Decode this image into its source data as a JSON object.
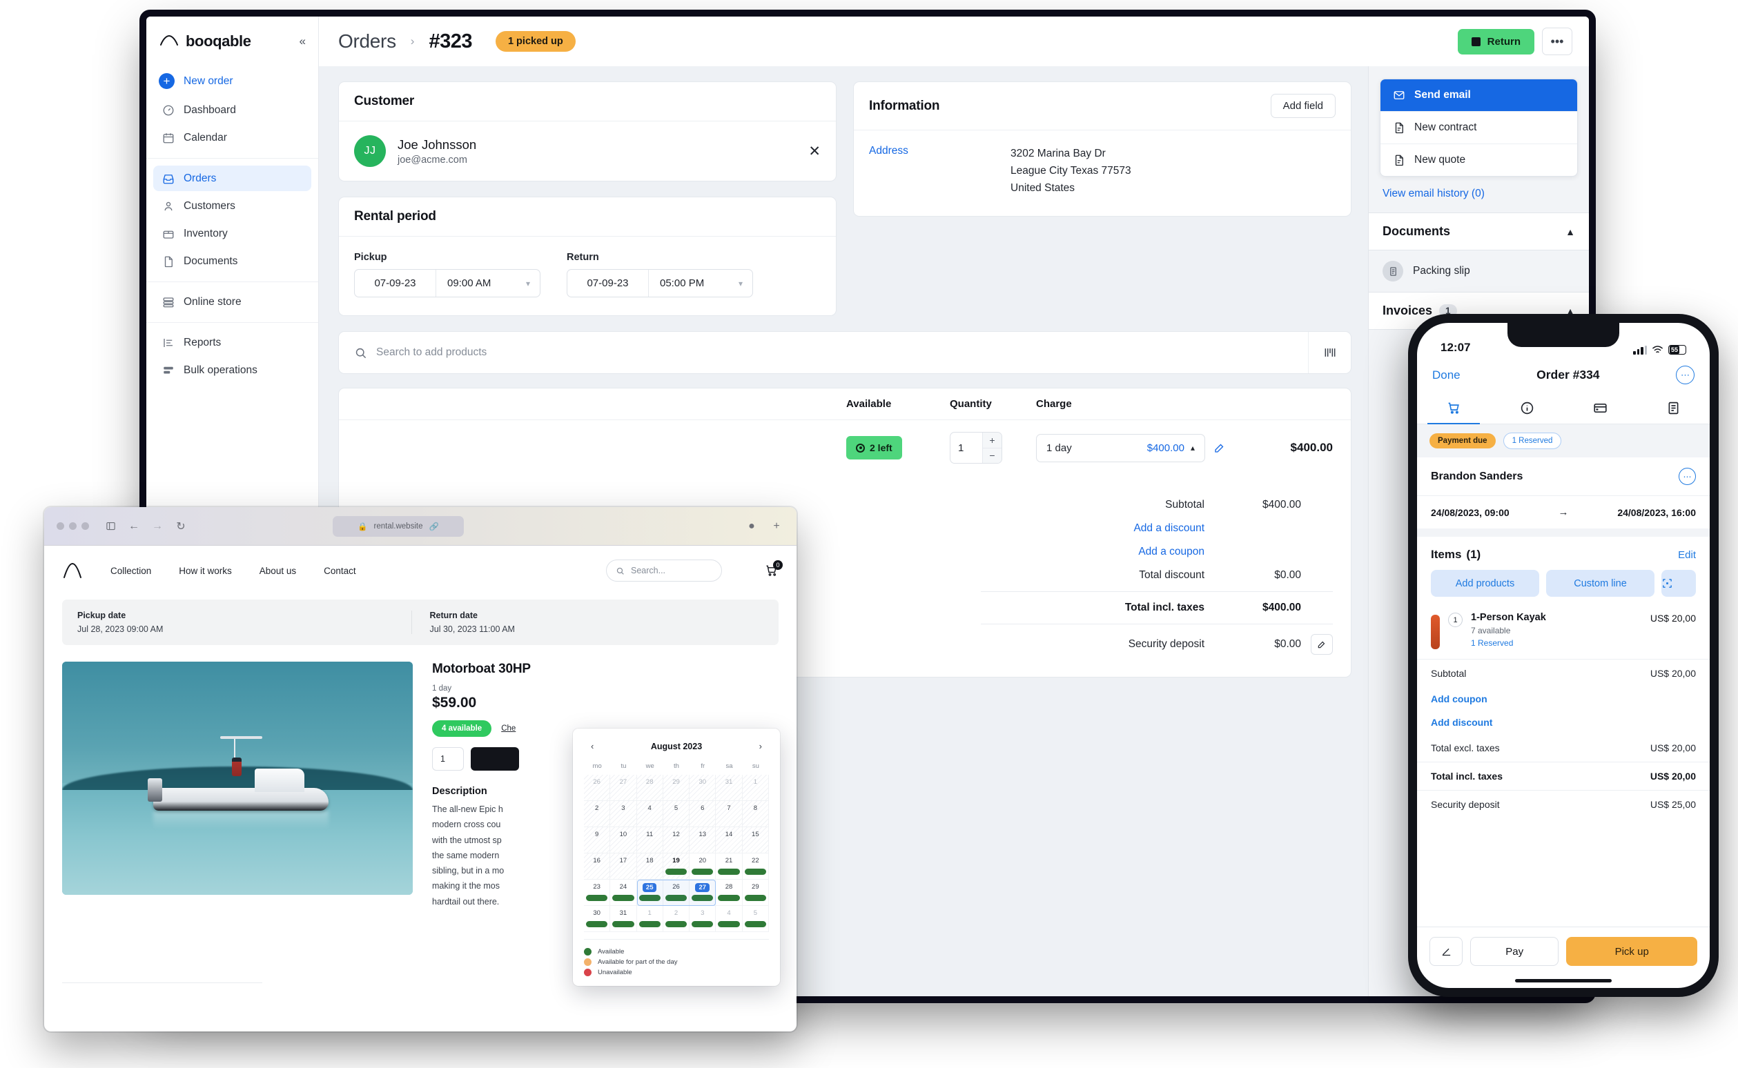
{
  "desktop": {
    "sidebar": {
      "brand": "booqable",
      "collapse_icon": "chevrons-left-icon",
      "groups": [
        {
          "items": [
            {
              "label": "New order",
              "icon": "plus-icon"
            },
            {
              "label": "Dashboard",
              "icon": "gauge-icon"
            },
            {
              "label": "Calendar",
              "icon": "calendar-icon"
            }
          ]
        },
        {
          "items": [
            {
              "label": "Orders",
              "icon": "inbox-icon"
            },
            {
              "label": "Customers",
              "icon": "user-icon"
            },
            {
              "label": "Inventory",
              "icon": "box-icon"
            },
            {
              "label": "Documents",
              "icon": "file-icon"
            }
          ]
        },
        {
          "items": [
            {
              "label": "Online store",
              "icon": "store-icon"
            }
          ]
        },
        {
          "items": [
            {
              "label": "Reports",
              "icon": "bar-chart-icon"
            },
            {
              "label": "Bulk operations",
              "icon": "layers-icon"
            }
          ]
        }
      ]
    },
    "topbar": {
      "breadcrumb_root": "Orders",
      "breadcrumb_sep": "›",
      "order_id": "#323",
      "status": "1 picked up",
      "return_button": "Return",
      "more_button": "•••"
    },
    "customer_card": {
      "title": "Customer",
      "initials": "JJ",
      "name": "Joe Johnsson",
      "email": "joe@acme.com",
      "close_icon": "close-icon"
    },
    "information_card": {
      "title": "Information",
      "add_field": "Add field",
      "address_label": "Address",
      "address_lines": [
        "3202 Marina Bay Dr",
        "League City Texas 77573",
        "United States"
      ]
    },
    "rental_card": {
      "title": "Rental period",
      "pickup_label": "Pickup",
      "pickup_date": "07-09-23",
      "pickup_time": "09:00 AM",
      "return_label": "Return",
      "return_date": "07-09-23",
      "return_time": "05:00 PM"
    },
    "product_search": {
      "placeholder": "Search to add products",
      "search_icon": "search-icon",
      "scan_icon": "barcode-scan-icon"
    },
    "products_table": {
      "columns": [
        "Available",
        "Quantity",
        "Charge",
        ""
      ],
      "rows": [
        {
          "available": "2 left",
          "quantity": "1",
          "charge_period": "1 day",
          "charge_amount": "$400.00",
          "total": "$400.00"
        }
      ]
    },
    "totals": {
      "subtotal_label": "Subtotal",
      "subtotal_value": "$400.00",
      "add_discount": "Add a discount",
      "add_coupon": "Add a coupon",
      "total_discount_label": "Total discount",
      "total_discount_value": "$0.00",
      "total_incl_label": "Total incl. taxes",
      "total_incl_value": "$400.00",
      "security_label": "Security deposit",
      "security_value": "$0.00"
    },
    "right_panel": {
      "email_menu": [
        {
          "label": "Send email",
          "icon": "mail-icon",
          "selected": true
        },
        {
          "label": "New contract",
          "icon": "document-icon",
          "selected": false
        },
        {
          "label": "New quote",
          "icon": "document-icon",
          "selected": false
        }
      ],
      "view_history": "View email history (0)",
      "documents_title": "Documents",
      "documents_items": [
        {
          "label": "Packing slip",
          "icon": "packing-slip-icon"
        }
      ],
      "invoices_title": "Invoices",
      "invoices_count": "1",
      "caret_icon": "chevron-up-icon"
    }
  },
  "browser": {
    "url": "rental.website",
    "lock_icon": "lock-icon",
    "nav_links": [
      "Collection",
      "How it works",
      "About us",
      "Contact"
    ],
    "search_placeholder": "Search...",
    "cart_count": "0",
    "dates": {
      "pickup_label": "Pickup date",
      "pickup_value": "Jul 28, 2023 09:00 AM",
      "return_label": "Return date",
      "return_value": "Jul 30, 2023 11:00 AM"
    },
    "product": {
      "title": "Motorboat 30HP",
      "period": "1 day",
      "price": "$59.00",
      "available": "4 available",
      "check_link": "Che",
      "qty": "1",
      "description_heading": "Description",
      "description": "The all-new Epic h modern cross cou with the utmost sp the same modern sibling, but in a mo making it the mos hardtail out there."
    },
    "calendar": {
      "title": "August 2023",
      "prev_icon": "chevron-left-icon",
      "next_icon": "chevron-right-icon",
      "dow": [
        "mo",
        "tu",
        "we",
        "th",
        "fr",
        "sa",
        "su"
      ],
      "weeks": [
        [
          {
            "n": "26",
            "dim": true,
            "hatch": true
          },
          {
            "n": "27",
            "dim": true,
            "hatch": true
          },
          {
            "n": "28",
            "dim": true,
            "hatch": true
          },
          {
            "n": "29",
            "dim": true,
            "hatch": true
          },
          {
            "n": "30",
            "dim": true,
            "hatch": true
          },
          {
            "n": "31",
            "dim": true,
            "hatch": true
          },
          {
            "n": "1",
            "dim": true,
            "hatch": true
          }
        ],
        [
          {
            "n": "2",
            "hatch": true
          },
          {
            "n": "3",
            "hatch": true
          },
          {
            "n": "4",
            "hatch": true
          },
          {
            "n": "5",
            "hatch": true
          },
          {
            "n": "6",
            "hatch": true
          },
          {
            "n": "7",
            "hatch": true
          },
          {
            "n": "8",
            "hatch": true
          }
        ],
        [
          {
            "n": "9",
            "hatch": true
          },
          {
            "n": "10",
            "hatch": true
          },
          {
            "n": "11",
            "hatch": true
          },
          {
            "n": "12",
            "hatch": true
          },
          {
            "n": "13",
            "hatch": true
          },
          {
            "n": "14",
            "hatch": true
          },
          {
            "n": "15",
            "hatch": true
          }
        ],
        [
          {
            "n": "16",
            "hatch": true
          },
          {
            "n": "17",
            "hatch": true
          },
          {
            "n": "18",
            "hatch": true
          },
          {
            "n": "19",
            "hatch": true,
            "bold": true,
            "bar": true
          },
          {
            "n": "20",
            "bar": true
          },
          {
            "n": "21",
            "bar": true
          },
          {
            "n": "22",
            "bar": true
          }
        ],
        [
          {
            "n": "23",
            "bar": true
          },
          {
            "n": "24",
            "bar": true
          },
          {
            "n": "25",
            "bar": true,
            "selected": true
          },
          {
            "n": "26",
            "bar": true
          },
          {
            "n": "27",
            "bar": true,
            "selected": true
          },
          {
            "n": "28",
            "bar": true
          },
          {
            "n": "29",
            "bar": true
          }
        ],
        [
          {
            "n": "30",
            "bar": true
          },
          {
            "n": "31",
            "bar": true
          },
          {
            "n": "1",
            "dim": true,
            "bar": true
          },
          {
            "n": "2",
            "dim": true,
            "bar": true
          },
          {
            "n": "3",
            "dim": true,
            "bar": true
          },
          {
            "n": "4",
            "dim": true,
            "bar": true
          },
          {
            "n": "5",
            "dim": true,
            "bar": true
          }
        ]
      ],
      "legend": [
        {
          "label": "Available",
          "color": "#2f7a37"
        },
        {
          "label": "Available for part of the day",
          "color": "#f3b26b"
        },
        {
          "label": "Unavailable",
          "color": "#d9434a"
        }
      ]
    }
  },
  "phone": {
    "status_time": "12:07",
    "battery": "55",
    "nav": {
      "left": "Done",
      "title": "Order #334",
      "more_icon": "ellipsis-circle-icon"
    },
    "tabs": [
      {
        "icon": "cart-icon",
        "active": true
      },
      {
        "icon": "info-circle-icon",
        "active": false
      },
      {
        "icon": "credit-card-icon",
        "active": false
      },
      {
        "icon": "document-icon",
        "active": false
      }
    ],
    "chips": [
      {
        "label": "Payment due",
        "type": "warn"
      },
      {
        "label": "1 Reserved",
        "type": "outline"
      }
    ],
    "customer": "Brandon Sanders",
    "date_from": "24/08/2023, 09:00",
    "date_arrow": "→",
    "date_to": "24/08/2023, 16:00",
    "items_heading": "Items",
    "items_count": "(1)",
    "items_edit": "Edit",
    "actions": [
      {
        "label": "Add products"
      },
      {
        "label": "Custom line"
      },
      {
        "label": "scan-icon"
      }
    ],
    "items": [
      {
        "qty": "1",
        "name": "1-Person Kayak",
        "available": "7 available",
        "reserved": "1 Reserved",
        "price": "US$ 20,00"
      }
    ],
    "summary": {
      "subtotal_label": "Subtotal",
      "subtotal_value": "US$ 20,00",
      "add_coupon": "Add coupon",
      "add_discount": "Add discount",
      "excl_label": "Total excl. taxes",
      "excl_value": "US$ 20,00",
      "incl_label": "Total incl. taxes",
      "incl_value": "US$ 20,00",
      "deposit_label": "Security deposit",
      "deposit_value": "US$ 25,00"
    },
    "footer": {
      "sign_icon": "signature-icon",
      "pay": "Pay",
      "pickup": "Pick up"
    }
  }
}
